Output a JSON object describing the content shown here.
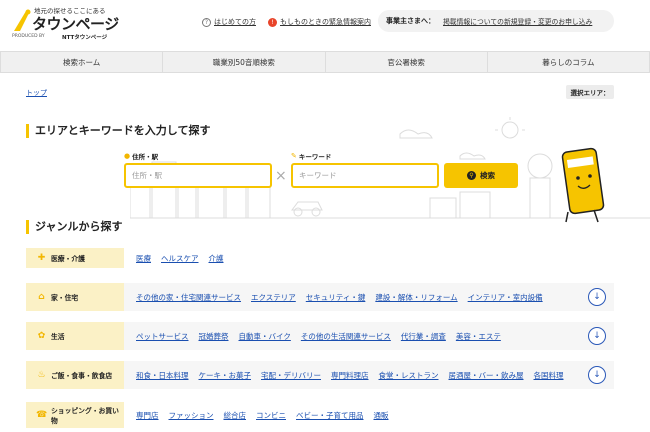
{
  "header": {
    "tagline": "地元の探せるここにある",
    "brand": "タウンページ",
    "produced_by": "PRODUCED BY",
    "ntt": "NTTタウンページ",
    "links": [
      {
        "icon": "question-icon",
        "label": "はじめての方"
      },
      {
        "icon": "alert-icon",
        "label": "もしものときの緊急情報案内"
      }
    ],
    "biz_label": "事業主さまへ：",
    "biz_link": "掲載情報についての新規登録・変更のお申し込み"
  },
  "nav": [
    "検索ホーム",
    "職業別50音順検索",
    "官公署検索",
    "暮らしのコラム"
  ],
  "breadcrumb": "トップ",
  "area_select": "選択エリア：",
  "search": {
    "title": "エリアとキーワードを入力して探す",
    "area_label": "住所・駅",
    "area_placeholder": "住所・駅",
    "keyword_label": "キーワード",
    "keyword_placeholder": "キーワード",
    "button": "検索"
  },
  "genre": {
    "title": "ジャンルから探す",
    "rows": [
      {
        "name": "医療・介護",
        "icon": "medical-icon",
        "links": [
          "医療",
          "ヘルスケア",
          "介護"
        ],
        "expand": false
      },
      {
        "name": "家・住宅",
        "icon": "house-icon",
        "links": [
          "その他の家・住宅関連サービス",
          "エクステリア",
          "セキュリティ・鍵",
          "建設・解体・リフォーム",
          "インテリア・室内設備"
        ],
        "expand": true
      },
      {
        "name": "生活",
        "icon": "life-icon",
        "links": [
          "ペットサービス",
          "冠婚葬祭",
          "自動車・バイク",
          "その他の生活関連サービス",
          "代行業・調査",
          "美容・エステ"
        ],
        "expand": true
      },
      {
        "name": "ご飯・食事・飲食店",
        "icon": "food-icon",
        "links": [
          "和食・日本料理",
          "ケーキ・お菓子",
          "宅配・デリバリー",
          "専門料理店",
          "食堂・レストラン",
          "居酒屋・バー・飲み屋",
          "各国料理"
        ],
        "expand": true
      },
      {
        "name": "ショッピング・お買い物",
        "icon": "shopping-icon",
        "links": [
          "専門店",
          "ファッション",
          "総合店",
          "コンビニ",
          "ベビー・子育て用品",
          "通販"
        ],
        "expand": false
      }
    ]
  },
  "colors": {
    "accent": "#f6c400",
    "link": "#1a4fb0",
    "category_bg": "#fbf1c6"
  }
}
